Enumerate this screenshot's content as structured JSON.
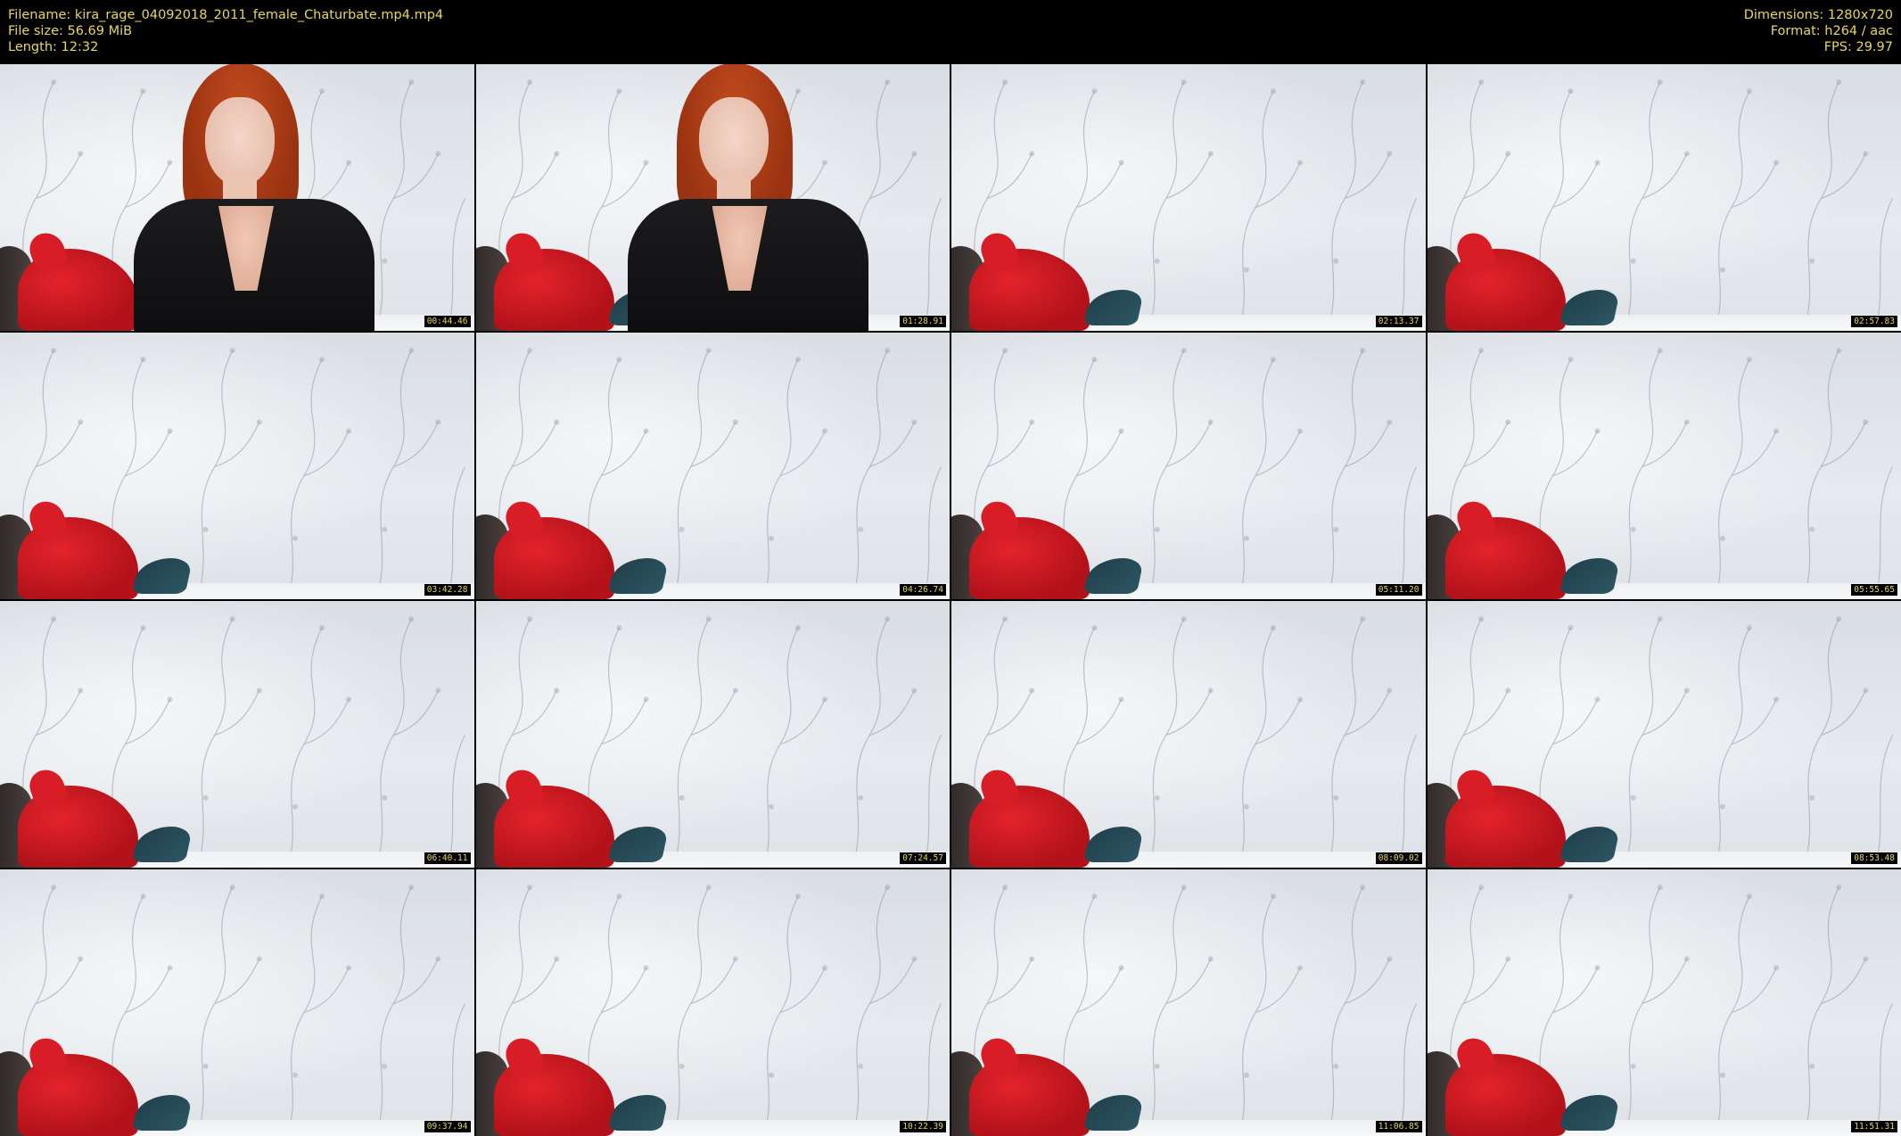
{
  "header": {
    "filename": "Filename: kira_rage_04092018_2011_female_Chaturbate.mp4.mp4",
    "filesize": "File size: 56.69 MiB",
    "length": "Length: 12:32",
    "dimensions": "Dimensions: 1280x720",
    "format": "Format: h264 / aac",
    "fps": "FPS: 29.97"
  },
  "colors": {
    "text": "#e8d75a",
    "background": "#000000"
  },
  "thumbnails": [
    {
      "timestamp": "00:44.46",
      "person": true
    },
    {
      "timestamp": "01:28.91",
      "person": true
    },
    {
      "timestamp": "02:13.37",
      "person": false
    },
    {
      "timestamp": "02:57.83",
      "person": false
    },
    {
      "timestamp": "03:42.28",
      "person": false
    },
    {
      "timestamp": "04:26.74",
      "person": false
    },
    {
      "timestamp": "05:11.20",
      "person": false
    },
    {
      "timestamp": "05:55.65",
      "person": false
    },
    {
      "timestamp": "06:40.11",
      "person": false
    },
    {
      "timestamp": "07:24.57",
      "person": false
    },
    {
      "timestamp": "08:09.02",
      "person": false
    },
    {
      "timestamp": "08:53.48",
      "person": false
    },
    {
      "timestamp": "09:37.94",
      "person": false
    },
    {
      "timestamp": "10:22.39",
      "person": false
    },
    {
      "timestamp": "11:06.85",
      "person": false
    },
    {
      "timestamp": "11:51.31",
      "person": false
    }
  ]
}
